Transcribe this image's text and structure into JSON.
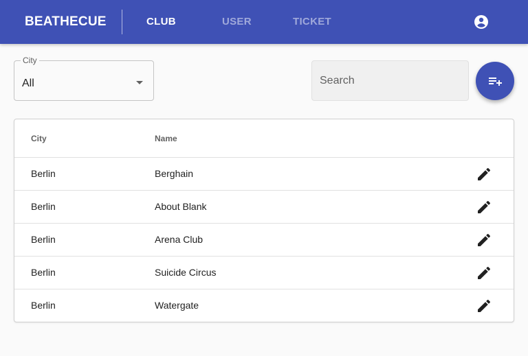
{
  "app": {
    "brand": "BEATHECUE"
  },
  "nav": {
    "club": "CLUB",
    "user": "USER",
    "ticket": "TICKET"
  },
  "icons": {
    "account": "account-circle-icon",
    "arrow": "arrow-drop-down-icon",
    "add": "playlist-add-icon",
    "edit": "pencil-icon"
  },
  "colors": {
    "primary": "#3f51b5",
    "background": "#fafafa"
  },
  "filter": {
    "label": "City",
    "value": "All"
  },
  "search": {
    "placeholder": "Search"
  },
  "table": {
    "headers": {
      "city": "City",
      "name": "Name"
    },
    "rows": [
      {
        "city": "Berlin",
        "name": "Berghain"
      },
      {
        "city": "Berlin",
        "name": "About Blank"
      },
      {
        "city": "Berlin",
        "name": "Arena Club"
      },
      {
        "city": "Berlin",
        "name": "Suicide Circus"
      },
      {
        "city": "Berlin",
        "name": "Watergate"
      }
    ]
  }
}
